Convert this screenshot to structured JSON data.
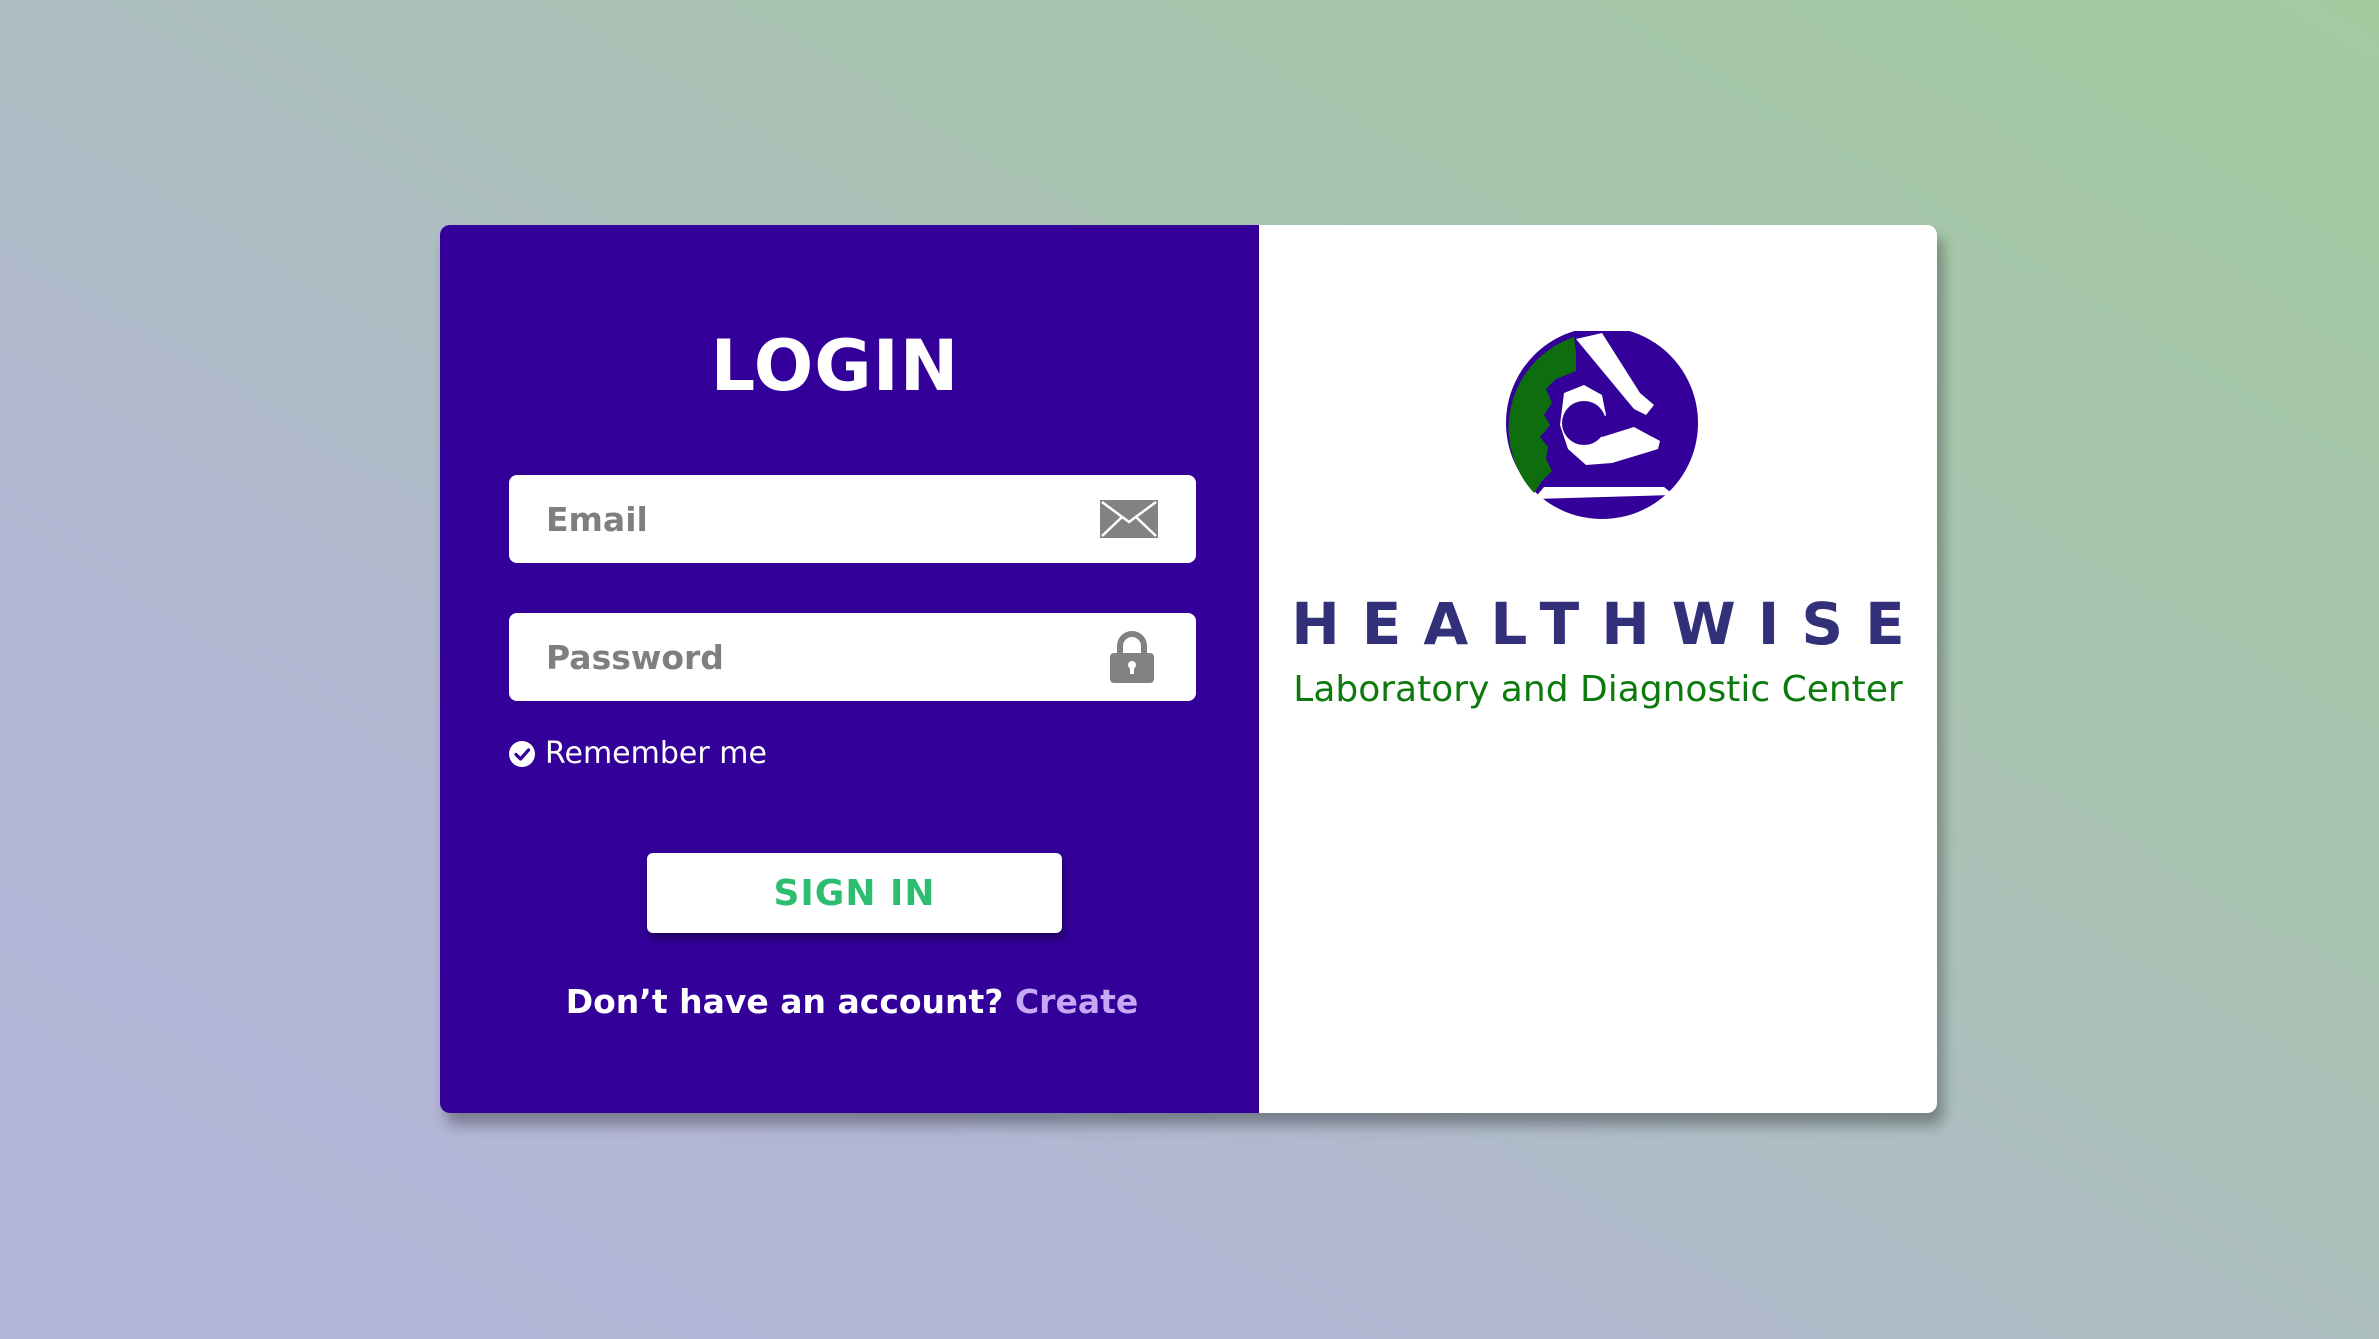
{
  "login": {
    "title": "LOGIN",
    "email_placeholder": "Email",
    "password_placeholder": "Password",
    "remember_label": "Remember me",
    "signin_label": "SIGN IN",
    "no_account_text": "Don’t have an account?",
    "create_link": "Create"
  },
  "brand": {
    "name": "HEALTHWISE",
    "tagline": "Laboratory and Diagnostic Center"
  },
  "icons": {
    "email": "envelope-icon",
    "password": "lock-icon",
    "remember": "check-circle-icon",
    "logo": "healthwise-microscope-logo"
  },
  "colors": {
    "panel": "#330099",
    "signin_text": "#2dbd6e",
    "create_link": "#c7a8f5",
    "brand_text": "#33307a",
    "tagline_text": "#0d7a0d",
    "logo_green": "#0e6e0e"
  }
}
